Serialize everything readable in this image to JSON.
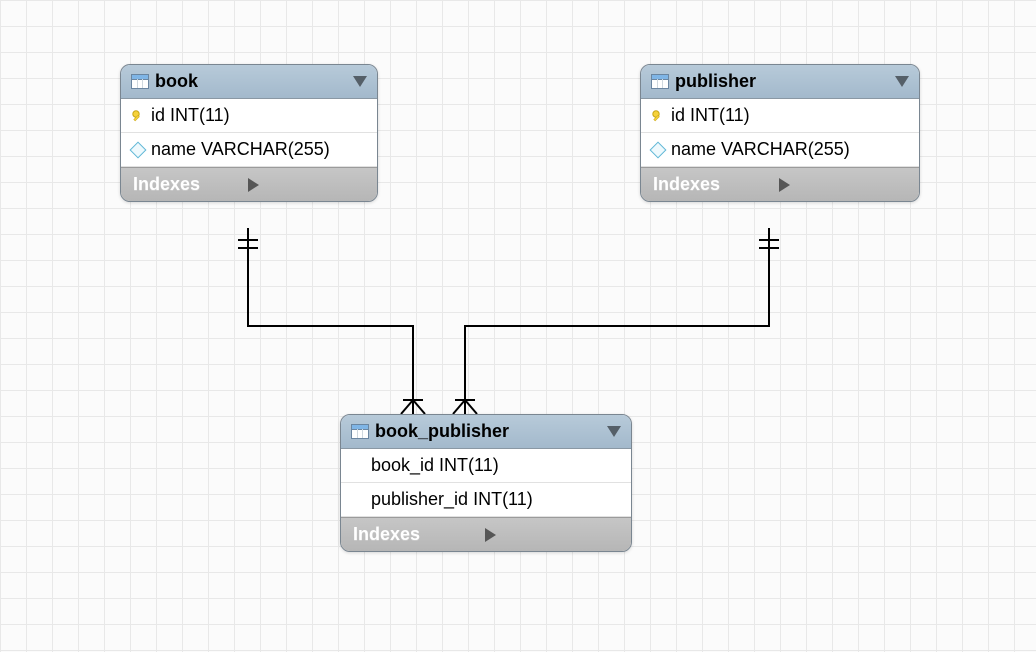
{
  "tables": [
    {
      "title": "book",
      "columns": [
        {
          "icon": "key",
          "text": "id INT(11)"
        },
        {
          "icon": "diamond",
          "text": "name VARCHAR(255)"
        }
      ],
      "indexes_label": "Indexes"
    },
    {
      "title": "publisher",
      "columns": [
        {
          "icon": "key",
          "text": "id INT(11)"
        },
        {
          "icon": "diamond",
          "text": "name VARCHAR(255)"
        }
      ],
      "indexes_label": "Indexes"
    },
    {
      "title": "book_publisher",
      "columns": [
        {
          "icon": "none",
          "text": "book_id INT(11)"
        },
        {
          "icon": "none",
          "text": "publisher_id INT(11)"
        }
      ],
      "indexes_label": "Indexes"
    }
  ],
  "relations": [
    {
      "from": "book",
      "to": "book_publisher",
      "cardinality": "one-to-many"
    },
    {
      "from": "publisher",
      "to": "book_publisher",
      "cardinality": "one-to-many"
    }
  ]
}
